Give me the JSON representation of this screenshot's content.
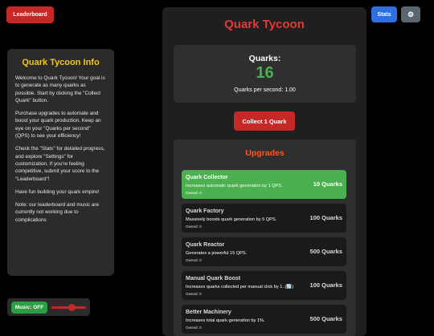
{
  "header": {
    "leaderboard_label": "Leaderboard",
    "stats_label": "Stats",
    "settings_icon": "gear-icon"
  },
  "info": {
    "title": "Quark Tycoon Info",
    "paragraphs": [
      "Welcome to Quark Tycoon! Your goal is to generate as many quarks as possible. Start by clicking the \"Collect Quark\" button.",
      "Purchase upgrades to automate and boost your quark production. Keep an eye on your \"Quarks per second\" (QPS) to see your efficiency!",
      "Check the \"Stats\" for detailed progress, and explore \"Settings\" for customization. If you're feeling competitive, submit your score to the \"Leaderboard\"!",
      "Have fun building your quark empire!",
      "Note: our leaderboard and music are currently not working due to complications"
    ]
  },
  "music": {
    "toggle_label": "Music: OFF",
    "volume": 0.6
  },
  "game": {
    "title": "Quark Tycoon",
    "quarks_label": "Quarks:",
    "quarks_value": "16",
    "qps_text": "Quarks per second: 1.00",
    "collect_label": "Collect 1 Quark"
  },
  "upgrades": {
    "title": "Upgrades",
    "items": [
      {
        "name": "Quark Collector",
        "desc": "Increases automatic quark generation by 1 QPS.",
        "owned": "Owned: 0",
        "cost": "10 Quarks",
        "affordable": true
      },
      {
        "name": "Quark Factory",
        "desc": "Massively boosts quark generation by 5 QPS.",
        "owned": "Owned: 0",
        "cost": "100 Quarks",
        "affordable": false
      },
      {
        "name": "Quark Reactor",
        "desc": "Generates a powerful 15 QPS.",
        "owned": "Owned: 0",
        "cost": "500 Quarks",
        "affordable": false
      },
      {
        "name": "Manual Quark Boost",
        "desc": "Increases quarks collected per manual click by 1. (🔄)",
        "owned": "Owned: 0",
        "cost": "100 Quarks",
        "affordable": false
      },
      {
        "name": "Better Machinery",
        "desc": "Increases total quark generation by 1%.",
        "owned": "Owned: 0",
        "cost": "500 Quarks",
        "affordable": false
      }
    ]
  }
}
